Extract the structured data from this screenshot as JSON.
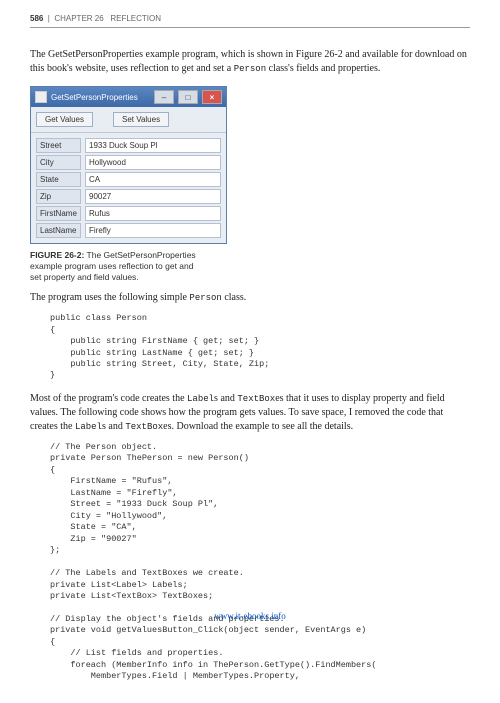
{
  "header": {
    "page_number": "586",
    "chapter": "CHAPTER 26",
    "title": "REFLECTION"
  },
  "para1_a": "The GetSetPersonProperties example program, which is shown in Figure 26-2 and available for download on this book's website, uses reflection to get and set a ",
  "para1_code": "Person",
  "para1_b": " class's fields and properties.",
  "window": {
    "title": "GetSetPersonProperties",
    "btn_get": "Get Values",
    "btn_set": "Set Values",
    "rows": [
      {
        "label": "Street",
        "value": "1933 Duck Soup Pl"
      },
      {
        "label": "City",
        "value": "Hollywood"
      },
      {
        "label": "State",
        "value": "CA"
      },
      {
        "label": "Zip",
        "value": "90027"
      },
      {
        "label": "FirstName",
        "value": "Rufus"
      },
      {
        "label": "LastName",
        "value": "Firefly"
      }
    ]
  },
  "figure_caption": {
    "label": "FIGURE 26-2:",
    "text": " The GetSetPersonProperties example program uses reflection to get and set property and field values."
  },
  "para2_a": "The program uses the following simple ",
  "para2_code": "Person",
  "para2_b": " class.",
  "code1": "public class Person\n{\n    public string FirstName { get; set; }\n    public string LastName { get; set; }\n    public string Street, City, State, Zip;\n}",
  "para3_a": "Most of the program's code creates the ",
  "para3_code1": "Label",
  "para3_b": "s and ",
  "para3_code2": "TextBox",
  "para3_c": "es that it uses to display property and field values. The following code shows how the program gets values. To save space, I removed the code that creates the ",
  "para3_code3": "Label",
  "para3_d": "s and ",
  "para3_code4": "TextBox",
  "para3_e": "es. Download the example to see all the details.",
  "code2": "// The Person object.\nprivate Person ThePerson = new Person()\n{\n    FirstName = \"Rufus\",\n    LastName = \"Firefly\",\n    Street = \"1933 Duck Soup Pl\",\n    City = \"Hollywood\",\n    State = \"CA\",\n    Zip = \"90027\"\n};\n\n// The Labels and TextBoxes we create.\nprivate List<Label> Labels;\nprivate List<TextBox> TextBoxes;\n\n// Display the object's fields and properties.\nprivate void getValuesButton_Click(object sender, EventArgs e)\n{\n    // List fields and properties.\n    foreach (MemberInfo info in ThePerson.GetType().FindMembers(\n        MemberTypes.Field | MemberTypes.Property,",
  "footer_link": "www.it-ebooks.info"
}
